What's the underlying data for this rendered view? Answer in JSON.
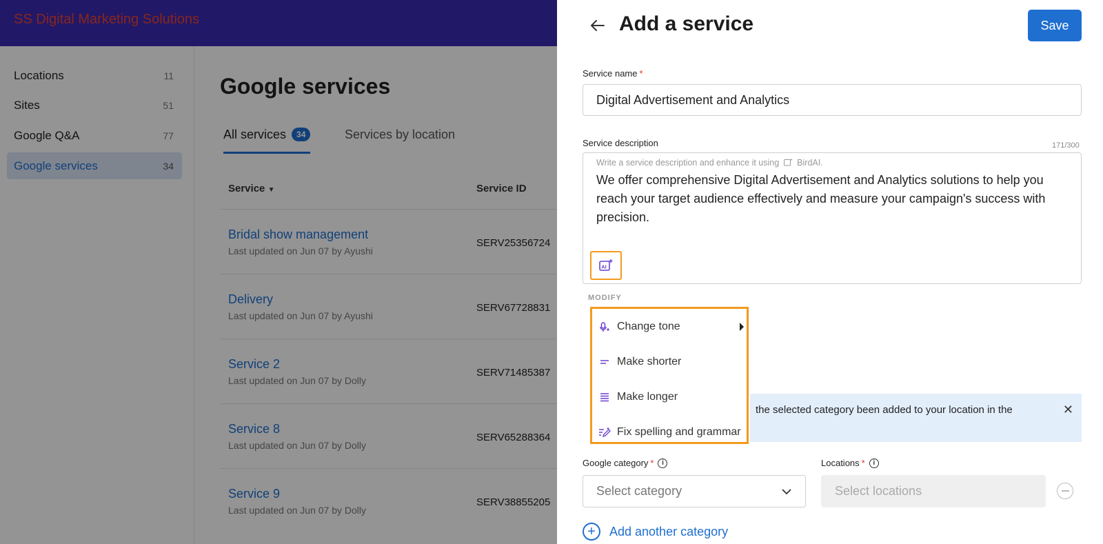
{
  "app": {
    "brand": "SS Digital Marketing Solutions"
  },
  "sidebar": {
    "items": [
      {
        "label": "Locations",
        "count": "11"
      },
      {
        "label": "Sites",
        "count": "51"
      },
      {
        "label": "Google Q&A",
        "count": "77"
      },
      {
        "label": "Google services",
        "count": "34",
        "active": true
      }
    ]
  },
  "main": {
    "title": "Google services",
    "tabs": [
      {
        "label": "All services",
        "badge": "34"
      },
      {
        "label": "Services by location"
      }
    ],
    "columns": {
      "service": "Service",
      "service_id": "Service ID"
    },
    "rows": [
      {
        "name": "Bridal show management",
        "sub": "Last updated on Jun 07 by Ayushi",
        "id": "SERV25356724"
      },
      {
        "name": "Delivery",
        "sub": "Last updated on Jun 07 by Ayushi",
        "id": "SERV67728831"
      },
      {
        "name": "Service 2",
        "sub": "Last updated on Jun 07 by Dolly",
        "id": "SERV71485387"
      },
      {
        "name": "Service 8",
        "sub": "Last updated on Jun 07 by Dolly",
        "id": "SERV65288364"
      },
      {
        "name": "Service 9",
        "sub": "Last updated on Jun 07 by Dolly",
        "id": "SERV38855205"
      }
    ]
  },
  "drawer": {
    "title": "Add a service",
    "save_label": "Save",
    "service_name_label": "Service name",
    "service_name_value": "Digital Advertisement and Analytics",
    "description_label": "Service description",
    "char_count": "171/300",
    "description_hint": "Write a service description and enhance it using",
    "description_hint_brand": "BirdAI.",
    "description_value": "We offer comprehensive Digital Advertisement and Analytics solutions to help you reach your target audience effectively and measure your campaign's success with precision.",
    "modify_label": "MODIFY",
    "menu": [
      {
        "label": "Change tone",
        "icon": "microphone-sparkle-icon",
        "has_submenu": true
      },
      {
        "label": "Make shorter",
        "icon": "short-lines-icon"
      },
      {
        "label": "Make longer",
        "icon": "long-lines-icon"
      },
      {
        "label": "Fix spelling and grammar",
        "icon": "pen-lines-icon"
      }
    ],
    "banner_text": "the selected category been added to your location in the",
    "google_category_label": "Google category",
    "category_placeholder": "Select category",
    "locations_label": "Locations",
    "locations_placeholder": "Select locations",
    "add_category_label": "Add another category"
  },
  "colors": {
    "primary": "#1e6fd0",
    "topbar": "#3c2ab4",
    "brand": "#e8432f",
    "highlight": "#f39a1e",
    "ai_purple": "#6a3fd1"
  }
}
